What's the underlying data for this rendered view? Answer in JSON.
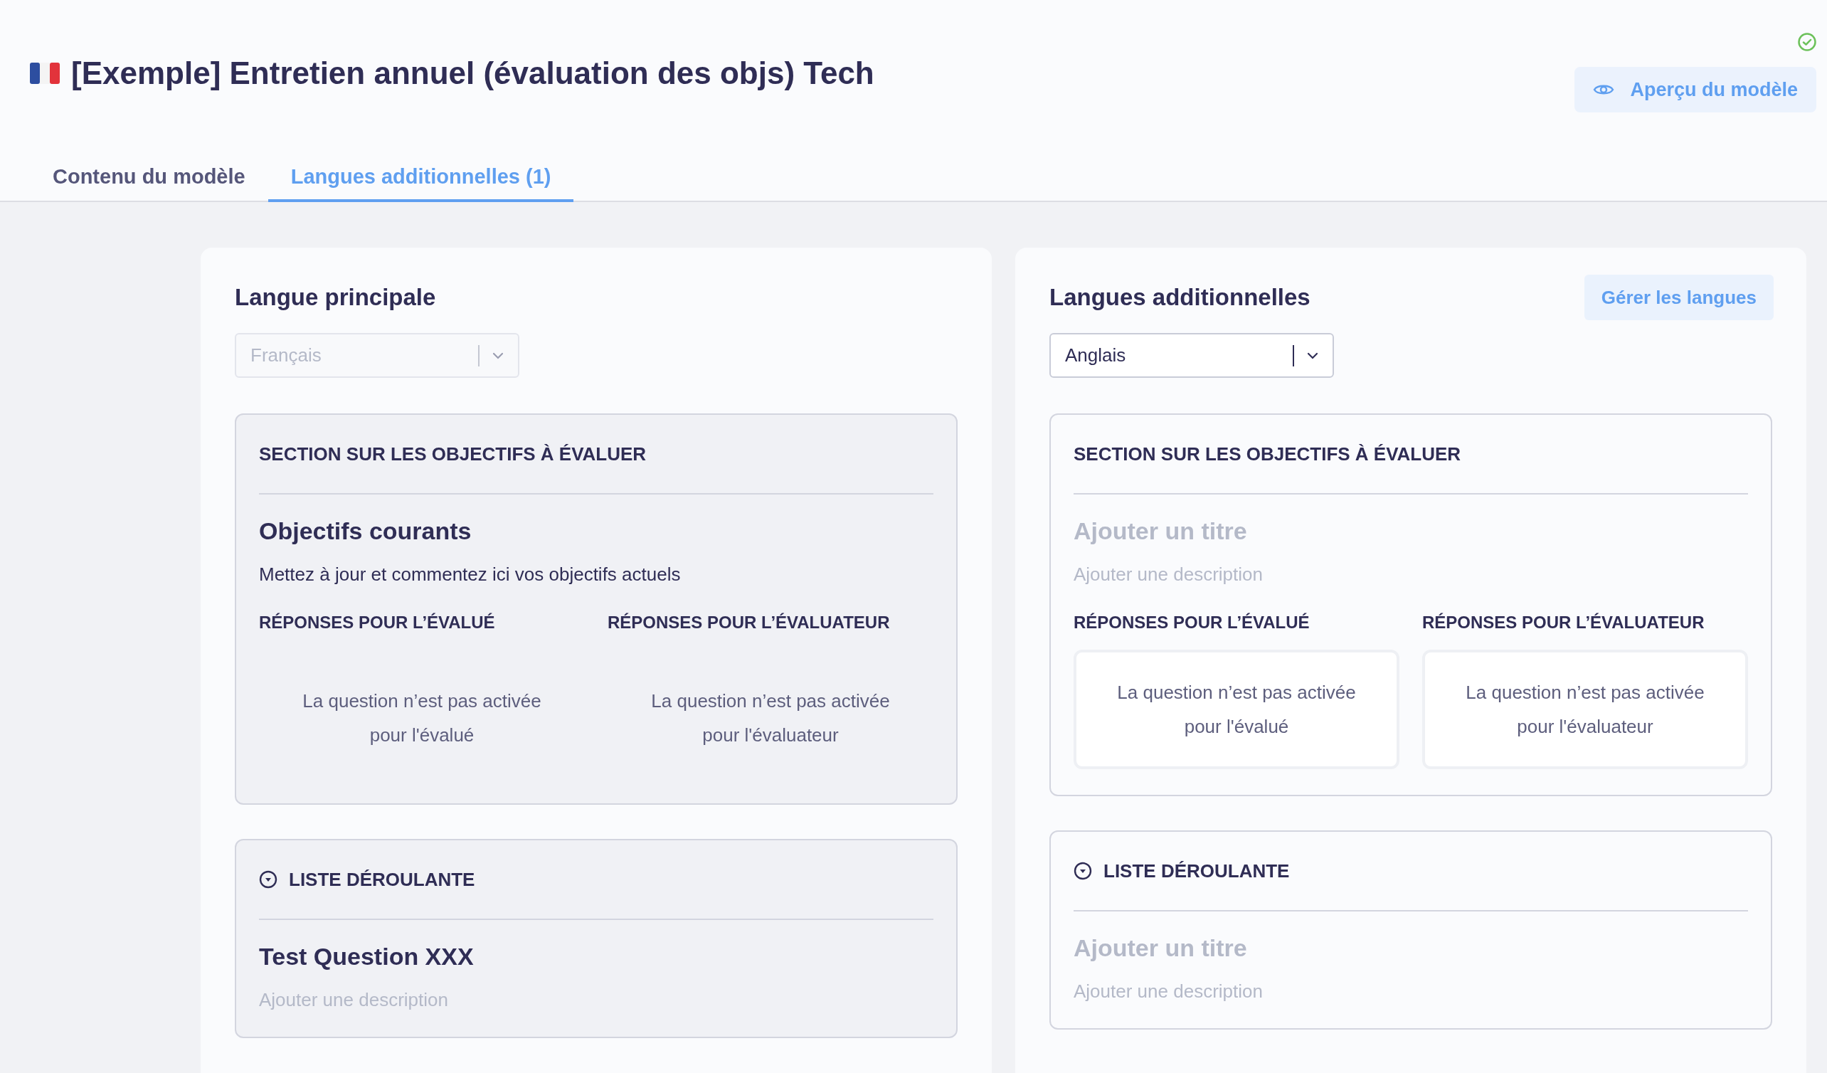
{
  "header": {
    "title": "[Exemple] Entretien annuel (évaluation des objs) Tech",
    "preview_button": "Aperçu du modèle"
  },
  "tabs": [
    {
      "label": "Contenu du modèle",
      "selected": false
    },
    {
      "label": "Langues additionnelles (1)",
      "selected": true
    }
  ],
  "panels": [
    {
      "title": "Langue principale",
      "language": {
        "value": "Français",
        "disabled": true
      },
      "read_only": true,
      "sections": [
        {
          "kind": "objectives",
          "type_label": "SECTION SUR LES OBJECTIFS À ÉVALUER",
          "title": {
            "value": "Objectifs courants"
          },
          "description": {
            "value": "Mettez à jour et commentez ici vos objectifs actuels"
          },
          "responses": [
            {
              "heading": "RÉPONSES POUR L’ÉVALUÉ",
              "message": "La question n’est pas activée pour l'évalué"
            },
            {
              "heading": "RÉPONSES POUR L’ÉVALUATEUR",
              "message": "La question n’est pas activée pour l'évaluateur"
            }
          ]
        },
        {
          "kind": "dropdown",
          "type_label": "LISTE DÉROULANTE",
          "title": {
            "value": "Test Question XXX"
          },
          "description": {
            "placeholder": "Ajouter une description"
          }
        }
      ]
    },
    {
      "title": "Langues additionnelles",
      "action_button": "Gérer les langues",
      "language": {
        "value": "Anglais",
        "disabled": false
      },
      "read_only": false,
      "sections": [
        {
          "kind": "objectives",
          "type_label": "SECTION SUR LES OBJECTIFS À ÉVALUER",
          "title": {
            "placeholder": "Ajouter un titre"
          },
          "description": {
            "placeholder": "Ajouter une description"
          },
          "responses": [
            {
              "heading": "RÉPONSES POUR L’ÉVALUÉ",
              "message": "La question n’est pas activée pour l'évalué"
            },
            {
              "heading": "RÉPONSES POUR L’ÉVALUATEUR",
              "message": "La question n’est pas activée pour l'évaluateur"
            }
          ]
        },
        {
          "kind": "dropdown",
          "type_label": "LISTE DÉROULANTE",
          "title": {
            "placeholder": "Ajouter un titre"
          },
          "description": {
            "placeholder": "Ajouter une description"
          }
        }
      ]
    }
  ]
}
